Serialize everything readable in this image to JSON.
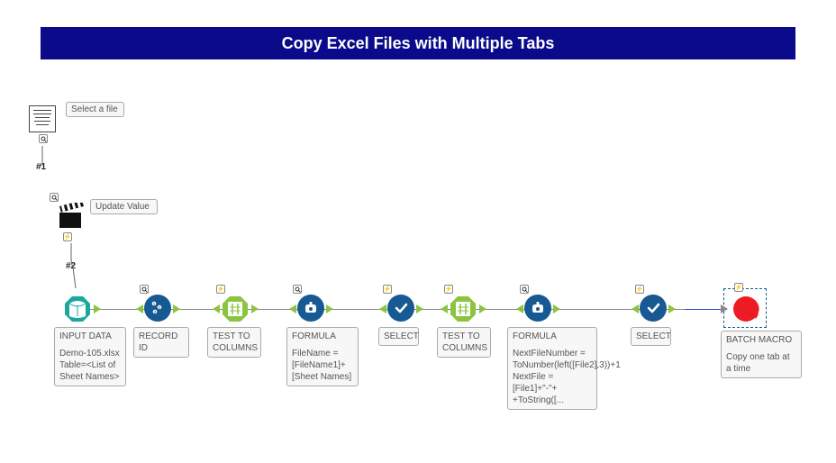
{
  "title": "Copy Excel Files with Multiple Tabs",
  "interface": {
    "select_file_label": "Select a file",
    "update_value_label": "Update Value",
    "pin1": "#1",
    "pin2": "#2"
  },
  "tools": {
    "input_data": {
      "name": "INPUT DATA",
      "detail_line1": "Demo-105.xlsx",
      "detail_line2": "Table=<List of Sheet Names>"
    },
    "record_id": {
      "name": "RECORD ID"
    },
    "text_to_columns_1": {
      "name": "TEST TO COLUMNS"
    },
    "formula_1": {
      "name": "FORMULA",
      "detail_line1": "FileName = [FileName1]+[Sheet Names]"
    },
    "select_1": {
      "name": "SELECT"
    },
    "text_to_columns_2": {
      "name": "TEST TO COLUMNS"
    },
    "formula_2": {
      "name": "FORMULA",
      "detail_line1": "NextFileNumber = ToNumber(left([File2],3))+1",
      "detail_line2": "NextFile = [File1]+\"-\"+",
      "detail_line3": "+ToString([..."
    },
    "select_2": {
      "name": "SELECT"
    },
    "batch_macro": {
      "name": "BATCH MACRO",
      "detail_line1": "Copy one tab at a time"
    }
  }
}
